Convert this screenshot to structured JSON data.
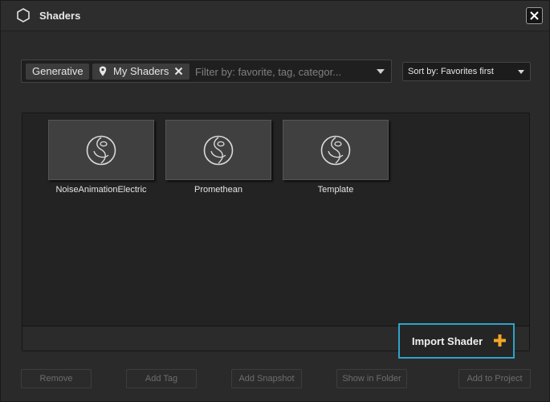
{
  "window": {
    "title": "Shaders",
    "icon": "hexagon-icon",
    "close_icon": "close-icon"
  },
  "filter": {
    "tags": [
      {
        "label": "Generative"
      },
      {
        "label": "My Shaders",
        "icon": "location-pin-icon",
        "removable": true
      }
    ],
    "placeholder": "Filter by: favorite, tag, categor...",
    "dropdown_icon": "chevron-down-icon"
  },
  "sort": {
    "selected": "Sort by: Favorites first"
  },
  "shaders": [
    {
      "name": "NoiseAnimationElectric",
      "icon": "shader-sphere-icon"
    },
    {
      "name": "Promethean",
      "icon": "shader-sphere-icon"
    },
    {
      "name": "Template",
      "icon": "shader-sphere-icon"
    }
  ],
  "import": {
    "label": "Import Shader",
    "icon": "plus-icon",
    "accent": "#f5a623",
    "highlight": "#2fa3c8"
  },
  "actions": {
    "remove": "Remove",
    "add_tag": "Add Tag",
    "add_snapshot": "Add Snapshot",
    "show_in_folder": "Show in Folder",
    "add_to_project": "Add to Project"
  }
}
